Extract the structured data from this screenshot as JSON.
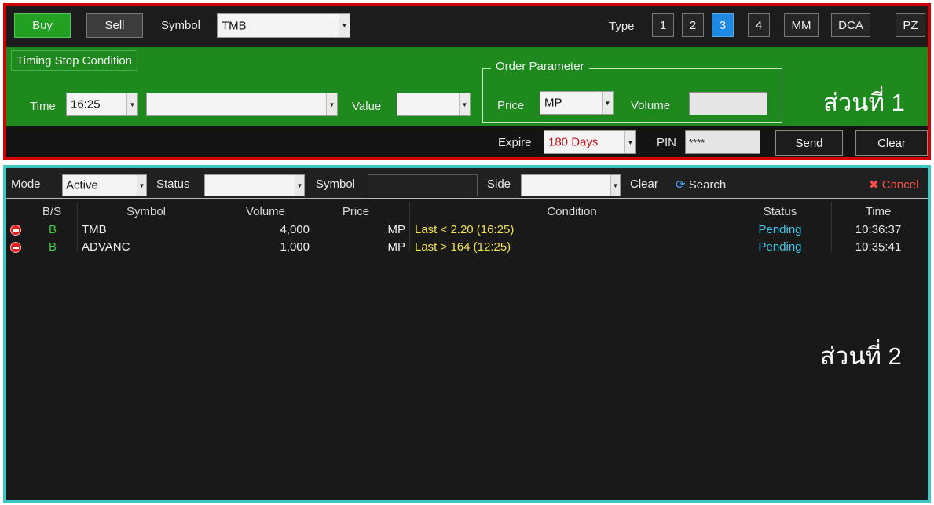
{
  "order_panel": {
    "buy_label": "Buy",
    "sell_label": "Sell",
    "symbol_label": "Symbol",
    "symbol_value": "TMB",
    "type_label": "Type",
    "type_buttons": [
      "1",
      "2",
      "3",
      "4",
      "MM",
      "DCA",
      "PZ"
    ],
    "active_type": "3",
    "timing_stop_label": "Timing Stop Condition",
    "time_label": "Time",
    "time_value": "16:25",
    "condition_value": "",
    "value_label": "Value",
    "value_value": "",
    "order_parameter_label": "Order Parameter",
    "price_label": "Price",
    "price_value": "MP",
    "volume_label": "Volume",
    "volume_value": "",
    "section_label": "ส่วนที่ 1",
    "expire_label": "Expire",
    "expire_value": "180 Days",
    "pin_label": "PIN",
    "pin_value": "****",
    "send_label": "Send",
    "clear_label": "Clear"
  },
  "order_list": {
    "mode_label": "Mode",
    "mode_value": "Active",
    "status_label": "Status",
    "status_value": "",
    "symbol_label": "Symbol",
    "symbol_value": "",
    "side_label": "Side",
    "side_value": "",
    "clear_label": "Clear",
    "search_label": "Search",
    "cancel_label": "Cancel",
    "columns": [
      "B/S",
      "Symbol",
      "Volume",
      "Price",
      "Condition",
      "Status",
      "Time"
    ],
    "rows": [
      {
        "side": "B",
        "symbol": "TMB",
        "volume": "4,000",
        "price": "MP",
        "condition": "Last < 2.20 (16:25)",
        "status": "Pending",
        "time": "10:36:37"
      },
      {
        "side": "B",
        "symbol": "ADVANC",
        "volume": "1,000",
        "price": "MP",
        "condition": "Last > 164 (12:25)",
        "status": "Pending",
        "time": "10:35:41"
      }
    ],
    "section_label": "ส่วนที่ 2"
  },
  "colors": {
    "section1_border": "#d40000",
    "section2_border": "#3cc7c0",
    "condition_bar": "#1e8a1e",
    "buy_button": "#22a022",
    "active_type": "#1e88e5",
    "pending_status": "#3ec6e8",
    "condition_text": "#f2e14a",
    "side_text": "#3ed23e",
    "expire_text": "#c0141e",
    "cancel_text": "#ff4a4a"
  },
  "icons": [
    "stop-icon",
    "refresh-icon",
    "cancel-x-icon",
    "chevron-down-icon"
  ]
}
